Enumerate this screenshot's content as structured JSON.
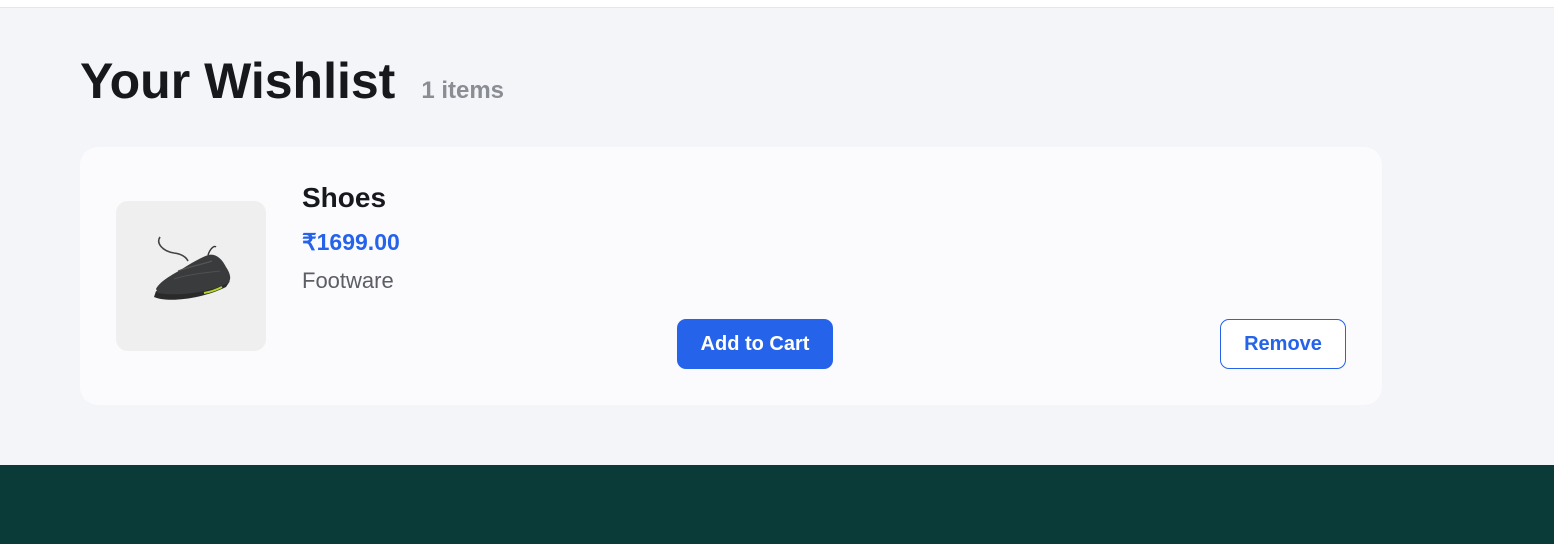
{
  "wishlist": {
    "title": "Your Wishlist",
    "count_label": "1 items",
    "items": [
      {
        "name": "Shoes",
        "price": "₹1699.00",
        "category": "Footware",
        "image_icon": "shoe-icon",
        "add_to_cart_label": "Add to Cart",
        "remove_label": "Remove"
      }
    ]
  },
  "colors": {
    "accent": "#2563eb",
    "footer_bg": "#0b3b38",
    "page_bg": "#f4f5f8"
  }
}
